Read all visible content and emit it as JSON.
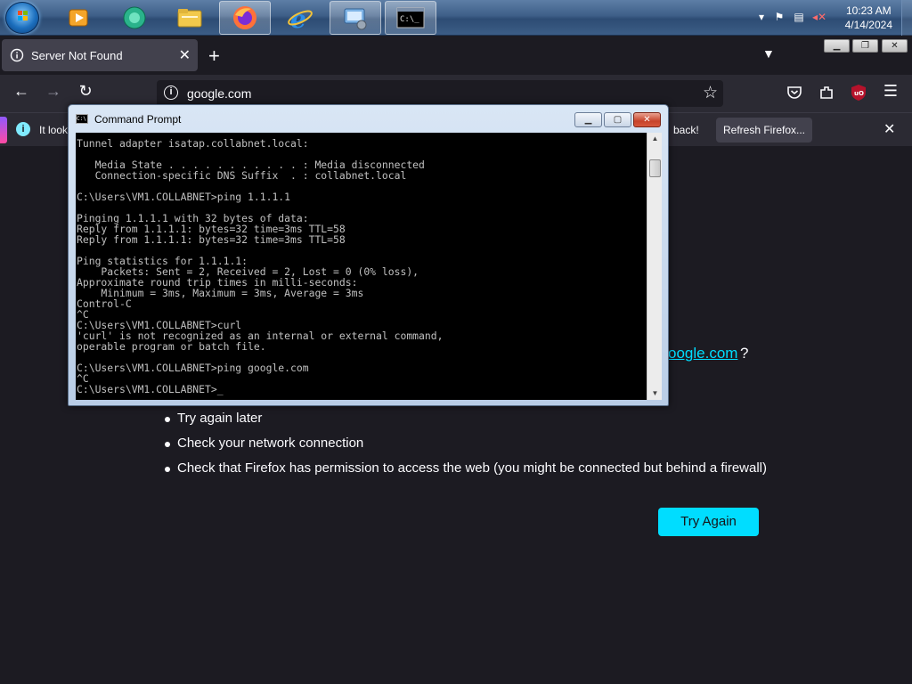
{
  "taskbar": {
    "apps": [
      {
        "name": "media-player-icon"
      },
      {
        "name": "messenger-icon"
      },
      {
        "name": "file-explorer-icon"
      },
      {
        "name": "firefox-icon"
      },
      {
        "name": "internet-explorer-icon"
      },
      {
        "name": "network-icon"
      },
      {
        "name": "command-prompt-icon"
      }
    ],
    "clock_time": "10:23 AM",
    "clock_date": "4/14/2024"
  },
  "firefox": {
    "tab_title": "Server Not Found",
    "url": "google.com",
    "notification_message": "It look",
    "notification_back": "back!",
    "refresh_label": "Refresh Firefox...",
    "link_text": "oogle.com",
    "link_suffix": "?",
    "tips": [
      "Try again later",
      "Check your network connection",
      "Check that Firefox has permission to access the web (you might be connected but behind a firewall)"
    ],
    "try_again_label": "Try Again"
  },
  "cmd": {
    "title": "Command Prompt",
    "lines": [
      "Tunnel adapter isatap.collabnet.local:",
      "",
      "   Media State . . . . . . . . . . . : Media disconnected",
      "   Connection-specific DNS Suffix  . : collabnet.local",
      "",
      "C:\\Users\\VM1.COLLABNET>ping 1.1.1.1",
      "",
      "Pinging 1.1.1.1 with 32 bytes of data:",
      "Reply from 1.1.1.1: bytes=32 time=3ms TTL=58",
      "Reply from 1.1.1.1: bytes=32 time=3ms TTL=58",
      "",
      "Ping statistics for 1.1.1.1:",
      "    Packets: Sent = 2, Received = 2, Lost = 0 (0% loss),",
      "Approximate round trip times in milli-seconds:",
      "    Minimum = 3ms, Maximum = 3ms, Average = 3ms",
      "Control-C",
      "^C",
      "C:\\Users\\VM1.COLLABNET>curl",
      "'curl' is not recognized as an internal or external command,",
      "operable program or batch file.",
      "",
      "C:\\Users\\VM1.COLLABNET>ping google.com",
      "^C",
      "C:\\Users\\VM1.COLLABNET>_"
    ]
  }
}
